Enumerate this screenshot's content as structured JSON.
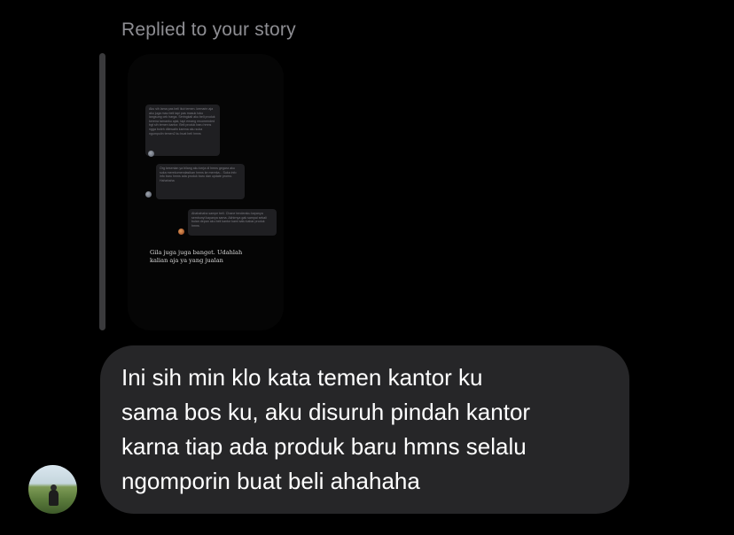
{
  "reply_header": "Replied to your story",
  "story": {
    "bubble_1": "Aku sih lama pas beli ikut temen. kemarin aja aku juga mau beli tapi pas masuk toko langsung cek harga. Seringkali aku beli produk kerena tamanku ajak, tapi emang recomended bgt sih temen kantor. Beli produk baru hmns ngga boleh dilewatin karena aku suka ngumpulin temen2 ku buat beli hmns",
    "bubble_2": "Org kesenian ya bilang aku kerja di hmns gegara aku suka merekomendasikan hmns ke mereka... Suka info info baru hmns ada produk baru dan update promo. Hahahaha",
    "bubble_3": "Ahahahaha sampe beli. Chane tenderaku kayanya sembunyi kayanya sama. Akhirnya gak sampai sekali bulan depan aku beli kantor kami satu kabar produk hmns",
    "caption": "Gila juga juga banget. Udahlah kalian aja ya yang jualan"
  },
  "message": {
    "text": "Ini sih min klo kata temen kantor ku\nsama bos ku, aku disuruh pindah kantor\nkarna tiap ada produk baru hmns selalu\nngomporin buat beli ahahaha"
  },
  "colors": {
    "background": "#000000",
    "bubble": "#262628",
    "label": "#8e8e93"
  }
}
